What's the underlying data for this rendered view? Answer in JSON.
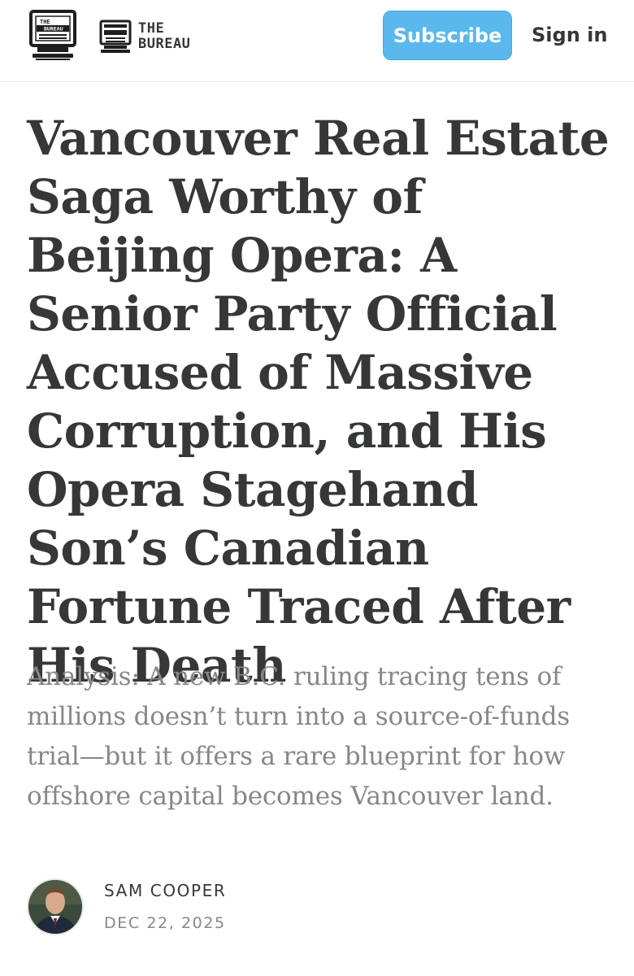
{
  "header": {
    "logo_text_top": "THE",
    "logo_text_bottom": "BUREAU",
    "wordmark_line1": "THE",
    "wordmark_line2": "BUREAU",
    "subscribe_label": "Subscribe",
    "signin_label": "Sign in"
  },
  "article": {
    "title": "Vancouver Real Estate Saga Worthy of Beijing Opera: A Senior Party Official Accused of Massive Corruption, and His Opera Stagehand Son’s Canadian Fortune Traced After His Death",
    "subtitle": "Analysis: A new B.C. ruling tracing tens of millions doesn’t turn into a source-of-funds trial—but it offers a rare blueprint for how offshore capital becomes Vancouver land.",
    "author": "SAM COOPER",
    "date": "DEC 22, 2025"
  },
  "colors": {
    "accent": "#5ab8ec",
    "text": "#363737",
    "muted": "#868787"
  },
  "icons": {
    "publication_logo": "computer-monitor-icon",
    "wordmark_icon": "computer-monitor-icon",
    "avatar": "author-photo"
  }
}
